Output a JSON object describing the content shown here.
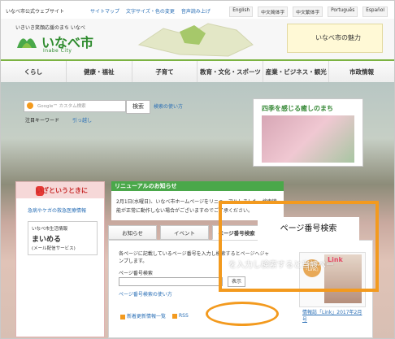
{
  "topbar": {
    "site_name": "いなべ市公式ウェブサイト",
    "links": [
      "サイトマップ",
      "文字サイズ・色の変更",
      "音声読み上げ"
    ],
    "languages": [
      "English",
      "中文简体字",
      "中文繁体字",
      "Português",
      "Español"
    ]
  },
  "header": {
    "tagline": "いきいき笑顔応援のまち いなべ",
    "title": "いなべ市",
    "subtitle": "Inabe City",
    "banner": "いなべ市の魅力"
  },
  "nav": {
    "items": [
      "くらし",
      "健康・福祉",
      "子育て",
      "教育・文化・スポーツ",
      "産業・ビジネス・観光",
      "市政情報"
    ]
  },
  "search": {
    "placeholder": "Google™ カスタム検索",
    "button": "検索",
    "help": "検索の使い方",
    "keywords_label": "注目キーワード",
    "keywords_link": "引っ越し"
  },
  "shiki": {
    "title": "四季を感じる癒しのまち"
  },
  "emergency": {
    "title": "いざというときに",
    "link": "急病やケガの救急医療情報",
    "mamoru_line1": "いなべ市生活情報",
    "mamoru_line2": "まいめる",
    "mamoru_line3": "(メール配信サービス)"
  },
  "renewal": {
    "title": "リニューアルのお知らせ",
    "body": "2月1日(水曜日)、いなべ市ホームページをリニューアルしました。検索機能が正常に動作しない場合がございますのでご了承ください。"
  },
  "tabs": [
    "お知らせ",
    "イベント",
    "ページ番号検索"
  ],
  "page_search": {
    "description": "各ページに記載しているページ番号を入力し検索するとページへジャンプします。",
    "label": "ページ番号検索",
    "show_button": "表示",
    "howto": "ページ番号検索の使い方",
    "new_info": "新着更新情報一覧",
    "rss": "RSS"
  },
  "link_ad": {
    "badge": "情報誌 『Link』",
    "cover_title": "Link",
    "caption": "情報誌「Link」2017年2月号"
  },
  "callout": {
    "label": "ページ番号検索",
    "text": "を入力し検索すると当該ペー"
  }
}
